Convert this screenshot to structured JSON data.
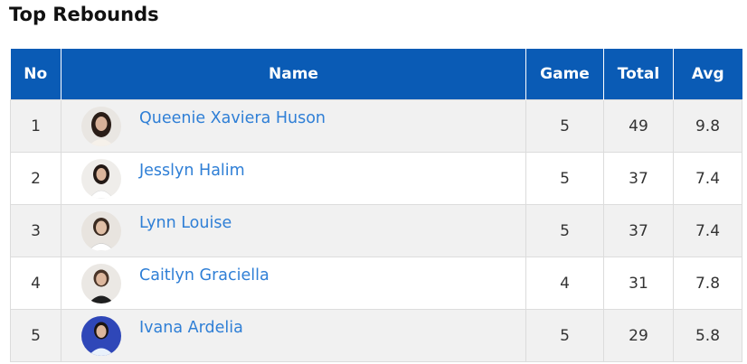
{
  "title": "Top Rebounds",
  "columns": {
    "no": "No",
    "name": "Name",
    "game": "Game",
    "total": "Total",
    "avg": "Avg"
  },
  "rows": [
    {
      "no": "1",
      "name": "Queenie Xaviera Huson",
      "game": "5",
      "total": "49",
      "avg": "9.8"
    },
    {
      "no": "2",
      "name": "Jesslyn Halim",
      "game": "5",
      "total": "37",
      "avg": "7.4"
    },
    {
      "no": "3",
      "name": "Lynn Louise",
      "game": "5",
      "total": "37",
      "avg": "7.4"
    },
    {
      "no": "4",
      "name": "Caitlyn Graciella",
      "game": "4",
      "total": "31",
      "avg": "7.8"
    },
    {
      "no": "5",
      "name": "Ivana Ardelia",
      "game": "5",
      "total": "29",
      "avg": "5.8"
    }
  ],
  "colors": {
    "header_bg": "#0a5bb5",
    "link": "#2f7fd6",
    "row_alt": "#f1f1f1"
  }
}
